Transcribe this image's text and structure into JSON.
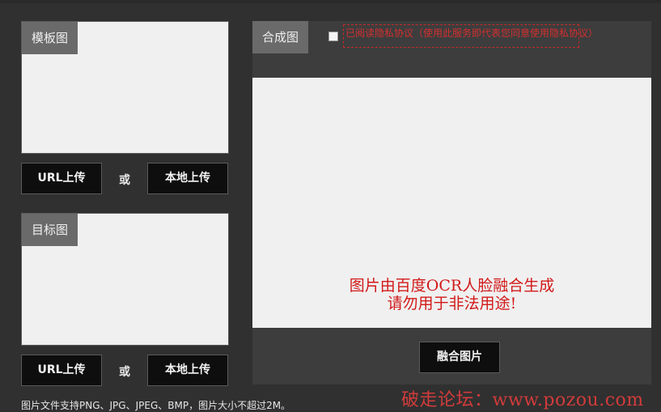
{
  "template": {
    "tag": "模板图",
    "url_button": "URL上传",
    "or": "或",
    "local_button": "本地上传"
  },
  "target": {
    "tag": "目标图",
    "url_button": "URL上传",
    "or": "或",
    "local_button": "本地上传"
  },
  "result": {
    "tag": "合成图",
    "notice": "已阅读隐私协议（使用此服务即代表您同意使用隐私协议）",
    "message_line1": "图片由百度OCR人脸融合生成",
    "message_line2": "请勿用于非法用途!",
    "merge_button": "融合图片"
  },
  "footer": {
    "note": "图片文件支持PNG、JPG、JPEG、BMP，图片大小不超过2M。"
  },
  "watermark": "破走论坛：www.pozou.com"
}
